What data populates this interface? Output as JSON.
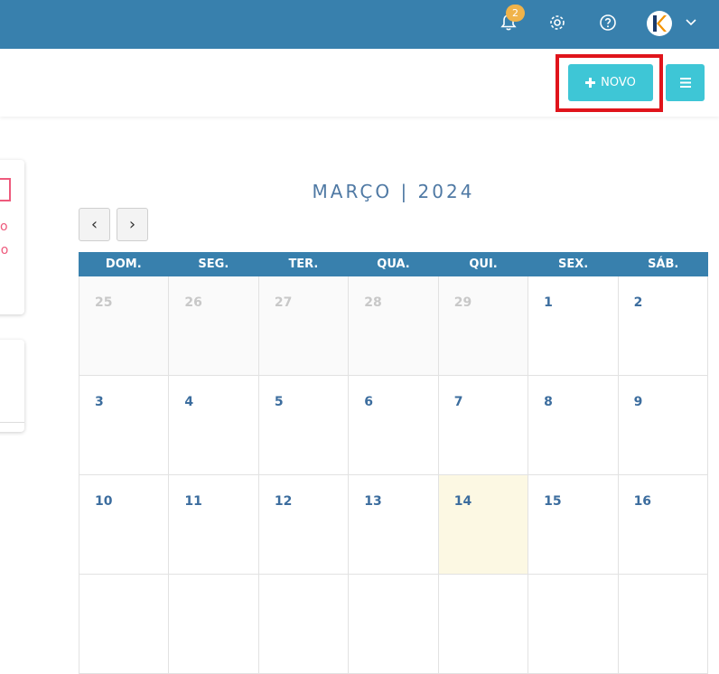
{
  "header": {
    "notification_count": "2",
    "icons": [
      "bell-icon",
      "gear-icon",
      "help-icon",
      "avatar",
      "chevron-down-icon"
    ],
    "avatar_letter": "k"
  },
  "toolbar": {
    "new_label": "NOVO",
    "menu_icon": "hamburger-icon"
  },
  "side_cards": {
    "card1_line1": "o",
    "card1_line2": "ido"
  },
  "calendar": {
    "month_title": "MARÇO | 2024",
    "prev_label": "‹",
    "next_label": "›",
    "weekdays": [
      "DOM.",
      "SEG.",
      "TER.",
      "QUA.",
      "QUI.",
      "SEX.",
      "SÁB."
    ],
    "weeks": [
      [
        "25",
        "26",
        "27",
        "28",
        "29",
        "1",
        "2"
      ],
      [
        "3",
        "4",
        "5",
        "6",
        "7",
        "8",
        "9"
      ],
      [
        "10",
        "11",
        "12",
        "13",
        "14",
        "15",
        "16"
      ],
      [
        "",
        "",
        "",
        "",
        "",
        "",
        ""
      ]
    ],
    "today": "14"
  },
  "colors": {
    "header_bg": "#3880ad",
    "accent_button": "#3ec6d6",
    "highlight_border": "#e0141b",
    "badge": "#f0b34a",
    "today_bg": "#fcf8e3",
    "day_number": "#3c6d9e"
  }
}
